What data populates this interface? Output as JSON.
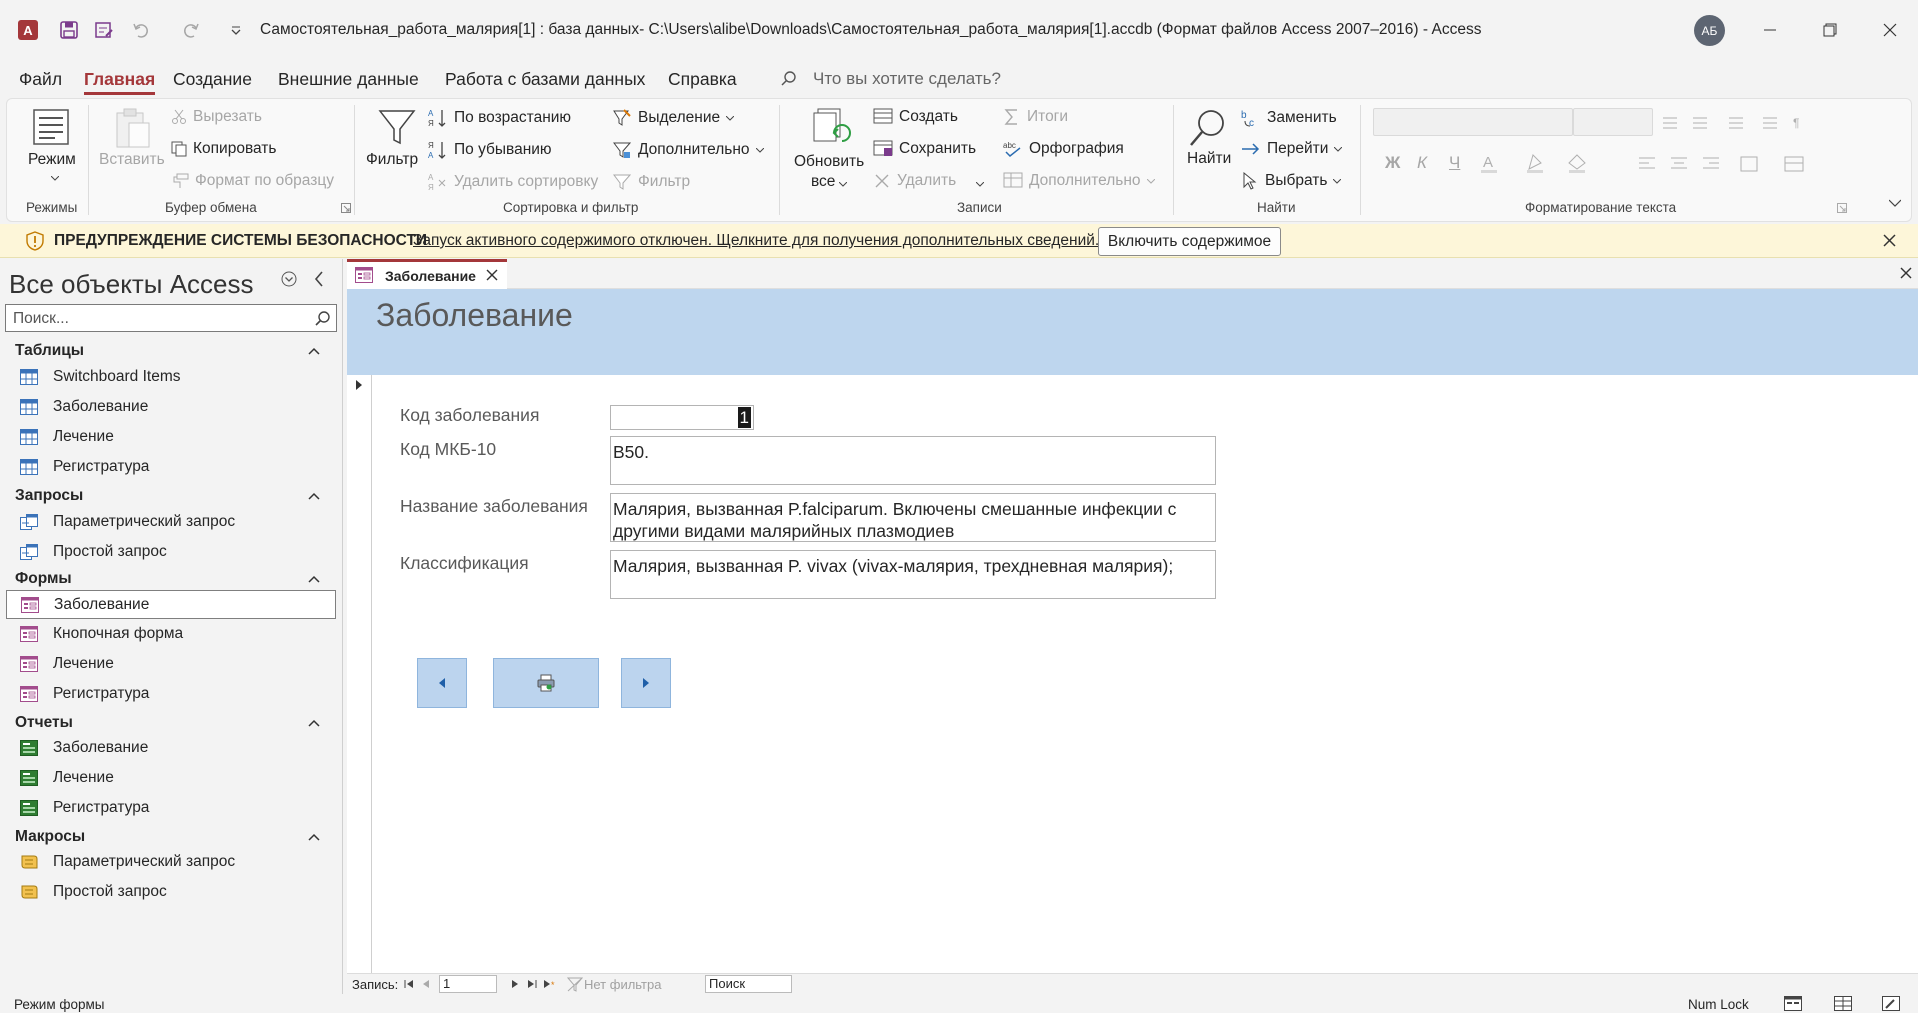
{
  "titlebar": {
    "document_title": "Самостоятельная_работа_малярия[1] : база данных- C:\\Users\\alibe\\Downloads\\Самостоятельная_работа_малярия[1].accdb (Формат файлов Access 2007–2016)  -  Access",
    "avatar_initials": "АБ"
  },
  "menu": {
    "tabs": [
      "Файл",
      "Главная",
      "Создание",
      "Внешние данные",
      "Работа с базами данных",
      "Справка"
    ],
    "active_tab": "Главная",
    "tell_me": "Что вы хотите сделать?"
  },
  "ribbon": {
    "modes": {
      "view": "Режим",
      "label": "Режимы"
    },
    "clipboard": {
      "paste": "Вставить",
      "cut": "Вырезать",
      "copy": "Копировать",
      "format_painter": "Формат по образцу",
      "label": "Буфер обмена"
    },
    "sort_filter": {
      "filter": "Фильтр",
      "ascending": "По возрастанию",
      "descending": "По убыванию",
      "remove_sort": "Удалить сортировку",
      "selection": "Выделение",
      "advanced": "Дополнительно",
      "toggle_filter": "Фильтр",
      "label": "Сортировка и фильтр"
    },
    "records": {
      "refresh_1": "Обновить",
      "refresh_2": "все",
      "new": "Создать",
      "save": "Сохранить",
      "delete": "Удалить",
      "totals": "Итоги",
      "spelling": "Орфография",
      "more": "Дополнительно",
      "label": "Записи"
    },
    "find": {
      "find": "Найти",
      "replace": "Заменить",
      "goto": "Перейти",
      "select": "Выбрать",
      "label": "Найти"
    },
    "text_formatting": {
      "bold": "Ж",
      "italic": "К",
      "underline": "Ч",
      "label": "Форматирование текста"
    }
  },
  "security_bar": {
    "title": "ПРЕДУПРЕЖДЕНИЕ СИСТЕМЫ БЕЗОПАСНОСТИ",
    "message": "Запуск активного содержимого отключен. Щелкните для получения дополнительных сведений.",
    "button": "Включить содержимое"
  },
  "nav_pane": {
    "title": "Все объекты Access",
    "search_placeholder": "Поиск...",
    "groups": [
      {
        "name": "Таблицы",
        "items": [
          "Switchboard Items",
          "Заболевание",
          "Лечение",
          "Регистратура"
        ]
      },
      {
        "name": "Запросы",
        "items": [
          "Параметрический запрос",
          "Простой запрос"
        ]
      },
      {
        "name": "Формы",
        "items": [
          "Заболевание",
          "Кнопочная форма",
          "Лечение",
          "Регистратура"
        ]
      },
      {
        "name": "Отчеты",
        "items": [
          "Заболевание",
          "Лечение",
          "Регистратура"
        ]
      },
      {
        "name": "Макросы",
        "items": [
          "Параметрический запрос",
          "Простой запрос"
        ]
      }
    ],
    "selected": "Формы/Заболевание"
  },
  "document": {
    "tab_title": "Заболевание",
    "form_title": "Заболевание",
    "fields": {
      "code_label": "Код заболевания",
      "code_value": "1",
      "icd_label": "Код МКБ-10",
      "icd_value": "B50.",
      "name_label": "Название заболевания",
      "name_value": "Малярия, вызванная P.falciparum. Включены смешанные инфекции с другими видами малярийных плазмодиев",
      "class_label": "Классификация",
      "class_value": "Малярия, вызванная P. vivax (vivax-малярия, трехдневная малярия);"
    }
  },
  "record_bar": {
    "label": "Запись:",
    "current": "1",
    "filter": "Нет фильтра",
    "search": "Поиск"
  },
  "status_bar": {
    "mode": "Режим формы",
    "num_lock": "Num Lock"
  },
  "colors": {
    "accent": "#a4373a",
    "form_header": "#bed6ee",
    "security_bar": "#fdf6d9"
  }
}
